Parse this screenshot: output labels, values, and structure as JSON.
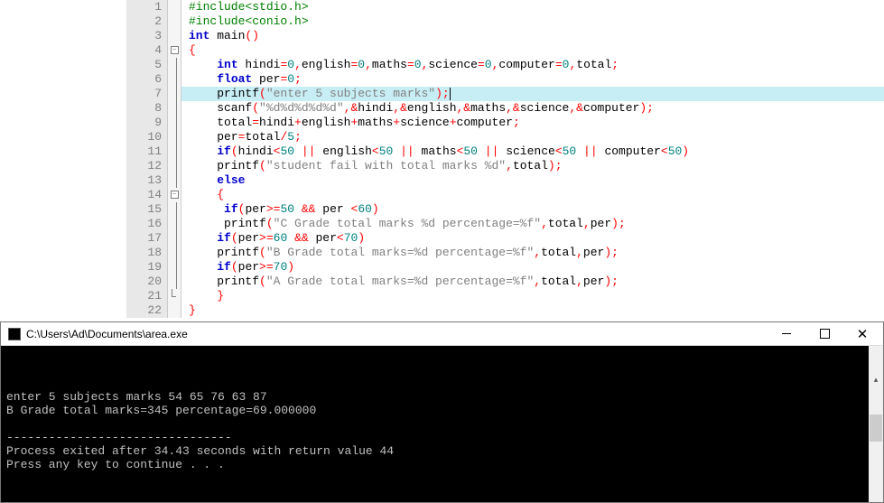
{
  "code_lines": [
    {
      "n": 1,
      "fold": "",
      "tokens": [
        {
          "c": "green",
          "t": "#include<stdio.h>"
        }
      ]
    },
    {
      "n": 2,
      "fold": "",
      "tokens": [
        {
          "c": "green",
          "t": "#include<conio.h>"
        }
      ]
    },
    {
      "n": 3,
      "fold": "",
      "tokens": [
        {
          "c": "blue",
          "t": "int"
        },
        {
          "c": "black",
          "t": " main"
        },
        {
          "c": "red",
          "t": "()"
        }
      ]
    },
    {
      "n": 4,
      "fold": "box",
      "tokens": [
        {
          "c": "red",
          "t": "{"
        }
      ]
    },
    {
      "n": 5,
      "fold": "line",
      "tokens": [
        {
          "c": "black",
          "t": "    "
        },
        {
          "c": "blue",
          "t": "int"
        },
        {
          "c": "black",
          "t": " hindi"
        },
        {
          "c": "red",
          "t": "="
        },
        {
          "c": "teal",
          "t": "0"
        },
        {
          "c": "red",
          "t": ","
        },
        {
          "c": "black",
          "t": "english"
        },
        {
          "c": "red",
          "t": "="
        },
        {
          "c": "teal",
          "t": "0"
        },
        {
          "c": "red",
          "t": ","
        },
        {
          "c": "black",
          "t": "maths"
        },
        {
          "c": "red",
          "t": "="
        },
        {
          "c": "teal",
          "t": "0"
        },
        {
          "c": "red",
          "t": ","
        },
        {
          "c": "black",
          "t": "science"
        },
        {
          "c": "red",
          "t": "="
        },
        {
          "c": "teal",
          "t": "0"
        },
        {
          "c": "red",
          "t": ","
        },
        {
          "c": "black",
          "t": "computer"
        },
        {
          "c": "red",
          "t": "="
        },
        {
          "c": "teal",
          "t": "0"
        },
        {
          "c": "red",
          "t": ","
        },
        {
          "c": "black",
          "t": "total"
        },
        {
          "c": "red",
          "t": ";"
        }
      ]
    },
    {
      "n": 6,
      "fold": "line",
      "tokens": [
        {
          "c": "black",
          "t": "    "
        },
        {
          "c": "blue",
          "t": "float"
        },
        {
          "c": "black",
          "t": " per"
        },
        {
          "c": "red",
          "t": "="
        },
        {
          "c": "teal",
          "t": "0"
        },
        {
          "c": "red",
          "t": ";"
        }
      ]
    },
    {
      "n": 7,
      "fold": "line",
      "highlight": true,
      "tokens": [
        {
          "c": "black",
          "t": "    printf"
        },
        {
          "c": "red",
          "t": "("
        },
        {
          "c": "gray",
          "t": "\"enter 5 subjects marks\""
        },
        {
          "c": "red",
          "t": ");"
        }
      ],
      "cursor": true
    },
    {
      "n": 8,
      "fold": "line",
      "tokens": [
        {
          "c": "black",
          "t": "    scanf"
        },
        {
          "c": "red",
          "t": "("
        },
        {
          "c": "gray",
          "t": "\"%d%d%d%d%d\""
        },
        {
          "c": "red",
          "t": ",&"
        },
        {
          "c": "black",
          "t": "hindi"
        },
        {
          "c": "red",
          "t": ",&"
        },
        {
          "c": "black",
          "t": "english"
        },
        {
          "c": "red",
          "t": ",&"
        },
        {
          "c": "black",
          "t": "maths"
        },
        {
          "c": "red",
          "t": ",&"
        },
        {
          "c": "black",
          "t": "science"
        },
        {
          "c": "red",
          "t": ",&"
        },
        {
          "c": "black",
          "t": "computer"
        },
        {
          "c": "red",
          "t": ");"
        }
      ]
    },
    {
      "n": 9,
      "fold": "line",
      "tokens": [
        {
          "c": "black",
          "t": "    total"
        },
        {
          "c": "red",
          "t": "="
        },
        {
          "c": "black",
          "t": "hindi"
        },
        {
          "c": "red",
          "t": "+"
        },
        {
          "c": "black",
          "t": "english"
        },
        {
          "c": "red",
          "t": "+"
        },
        {
          "c": "black",
          "t": "maths"
        },
        {
          "c": "red",
          "t": "+"
        },
        {
          "c": "black",
          "t": "science"
        },
        {
          "c": "red",
          "t": "+"
        },
        {
          "c": "black",
          "t": "computer"
        },
        {
          "c": "red",
          "t": ";"
        }
      ]
    },
    {
      "n": 10,
      "fold": "line",
      "tokens": [
        {
          "c": "black",
          "t": "    per"
        },
        {
          "c": "red",
          "t": "="
        },
        {
          "c": "black",
          "t": "total"
        },
        {
          "c": "red",
          "t": "/"
        },
        {
          "c": "teal",
          "t": "5"
        },
        {
          "c": "red",
          "t": ";"
        }
      ]
    },
    {
      "n": 11,
      "fold": "line",
      "tokens": [
        {
          "c": "black",
          "t": "    "
        },
        {
          "c": "blue",
          "t": "if"
        },
        {
          "c": "red",
          "t": "("
        },
        {
          "c": "black",
          "t": "hindi"
        },
        {
          "c": "red",
          "t": "<"
        },
        {
          "c": "teal",
          "t": "50"
        },
        {
          "c": "red",
          "t": " || "
        },
        {
          "c": "black",
          "t": "english"
        },
        {
          "c": "red",
          "t": "<"
        },
        {
          "c": "teal",
          "t": "50"
        },
        {
          "c": "red",
          "t": " || "
        },
        {
          "c": "black",
          "t": "maths"
        },
        {
          "c": "red",
          "t": "<"
        },
        {
          "c": "teal",
          "t": "50"
        },
        {
          "c": "red",
          "t": " || "
        },
        {
          "c": "black",
          "t": "science"
        },
        {
          "c": "red",
          "t": "<"
        },
        {
          "c": "teal",
          "t": "50"
        },
        {
          "c": "red",
          "t": " || "
        },
        {
          "c": "black",
          "t": "computer"
        },
        {
          "c": "red",
          "t": "<"
        },
        {
          "c": "teal",
          "t": "50"
        },
        {
          "c": "red",
          "t": ")"
        }
      ]
    },
    {
      "n": 12,
      "fold": "line",
      "tokens": [
        {
          "c": "black",
          "t": "    printf"
        },
        {
          "c": "red",
          "t": "("
        },
        {
          "c": "gray",
          "t": "\"student fail with total marks %d\""
        },
        {
          "c": "red",
          "t": ","
        },
        {
          "c": "black",
          "t": "total"
        },
        {
          "c": "red",
          "t": ");"
        }
      ]
    },
    {
      "n": 13,
      "fold": "line",
      "tokens": [
        {
          "c": "black",
          "t": "    "
        },
        {
          "c": "blue",
          "t": "else"
        }
      ]
    },
    {
      "n": 14,
      "fold": "box",
      "tokens": [
        {
          "c": "black",
          "t": "    "
        },
        {
          "c": "red",
          "t": "{"
        }
      ]
    },
    {
      "n": 15,
      "fold": "line",
      "tokens": [
        {
          "c": "black",
          "t": "     "
        },
        {
          "c": "blue",
          "t": "if"
        },
        {
          "c": "red",
          "t": "("
        },
        {
          "c": "black",
          "t": "per"
        },
        {
          "c": "red",
          "t": ">="
        },
        {
          "c": "teal",
          "t": "50"
        },
        {
          "c": "red",
          "t": " && "
        },
        {
          "c": "black",
          "t": "per "
        },
        {
          "c": "red",
          "t": "<"
        },
        {
          "c": "teal",
          "t": "60"
        },
        {
          "c": "red",
          "t": ")"
        }
      ]
    },
    {
      "n": 16,
      "fold": "line",
      "tokens": [
        {
          "c": "black",
          "t": "     printf"
        },
        {
          "c": "red",
          "t": "("
        },
        {
          "c": "gray",
          "t": "\"C Grade total marks %d percentage=%f\""
        },
        {
          "c": "red",
          "t": ","
        },
        {
          "c": "black",
          "t": "total"
        },
        {
          "c": "red",
          "t": ","
        },
        {
          "c": "black",
          "t": "per"
        },
        {
          "c": "red",
          "t": ");"
        }
      ]
    },
    {
      "n": 17,
      "fold": "line",
      "tokens": [
        {
          "c": "black",
          "t": "    "
        },
        {
          "c": "blue",
          "t": "if"
        },
        {
          "c": "red",
          "t": "("
        },
        {
          "c": "black",
          "t": "per"
        },
        {
          "c": "red",
          "t": ">="
        },
        {
          "c": "teal",
          "t": "60"
        },
        {
          "c": "red",
          "t": " && "
        },
        {
          "c": "black",
          "t": "per"
        },
        {
          "c": "red",
          "t": "<"
        },
        {
          "c": "teal",
          "t": "70"
        },
        {
          "c": "red",
          "t": ")"
        }
      ]
    },
    {
      "n": 18,
      "fold": "line",
      "tokens": [
        {
          "c": "black",
          "t": "    printf"
        },
        {
          "c": "red",
          "t": "("
        },
        {
          "c": "gray",
          "t": "\"B Grade total marks=%d percentage=%f\""
        },
        {
          "c": "red",
          "t": ","
        },
        {
          "c": "black",
          "t": "total"
        },
        {
          "c": "red",
          "t": ","
        },
        {
          "c": "black",
          "t": "per"
        },
        {
          "c": "red",
          "t": ");"
        }
      ]
    },
    {
      "n": 19,
      "fold": "line",
      "tokens": [
        {
          "c": "black",
          "t": "    "
        },
        {
          "c": "blue",
          "t": "if"
        },
        {
          "c": "red",
          "t": "("
        },
        {
          "c": "black",
          "t": "per"
        },
        {
          "c": "red",
          "t": ">="
        },
        {
          "c": "teal",
          "t": "70"
        },
        {
          "c": "red",
          "t": ")"
        }
      ]
    },
    {
      "n": 20,
      "fold": "line",
      "tokens": [
        {
          "c": "black",
          "t": "    printf"
        },
        {
          "c": "red",
          "t": "("
        },
        {
          "c": "gray",
          "t": "\"A Grade total marks=%d percentage=%f\""
        },
        {
          "c": "red",
          "t": ","
        },
        {
          "c": "black",
          "t": "total"
        },
        {
          "c": "red",
          "t": ","
        },
        {
          "c": "black",
          "t": "per"
        },
        {
          "c": "red",
          "t": ");"
        }
      ]
    },
    {
      "n": 21,
      "fold": "end",
      "tokens": [
        {
          "c": "black",
          "t": "    "
        },
        {
          "c": "red",
          "t": "}"
        }
      ]
    },
    {
      "n": 22,
      "fold": "",
      "tokens": [
        {
          "c": "red",
          "t": "}"
        }
      ]
    }
  ],
  "console": {
    "title": "C:\\Users\\Ad\\Documents\\area.exe",
    "lines": [
      "enter 5 subjects marks 54 65 76 63 87",
      "B Grade total marks=345 percentage=69.000000",
      "",
      "--------------------------------",
      "Process exited after 34.43 seconds with return value 44",
      "Press any key to continue . . ."
    ]
  }
}
